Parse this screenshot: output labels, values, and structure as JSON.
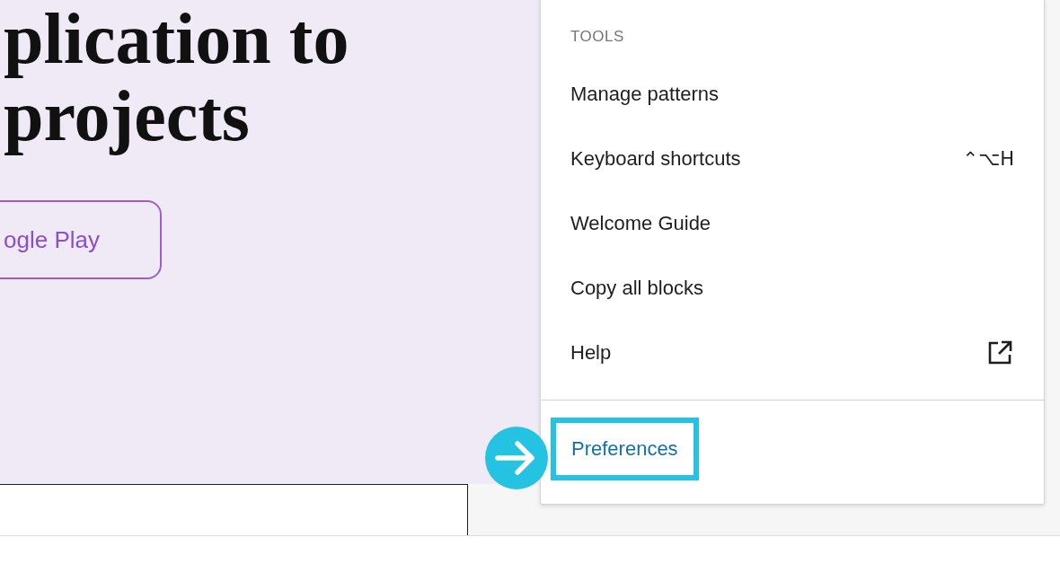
{
  "canvas": {
    "heading_lines": [
      "plication to",
      "projects"
    ],
    "button": "ogle Play"
  },
  "menu": {
    "section_label": "TOOLS",
    "items": [
      {
        "label": "Manage patterns",
        "kind": "plain"
      },
      {
        "label": "Keyboard shortcuts",
        "kind": "plain",
        "shortcut": "⌃⌥H"
      },
      {
        "label": "Welcome Guide",
        "kind": "plain"
      },
      {
        "label": "Copy all blocks",
        "kind": "plain"
      },
      {
        "label": "Help",
        "kind": "external"
      }
    ],
    "footer_item": {
      "label": "Preferences",
      "highlighted": true
    }
  }
}
